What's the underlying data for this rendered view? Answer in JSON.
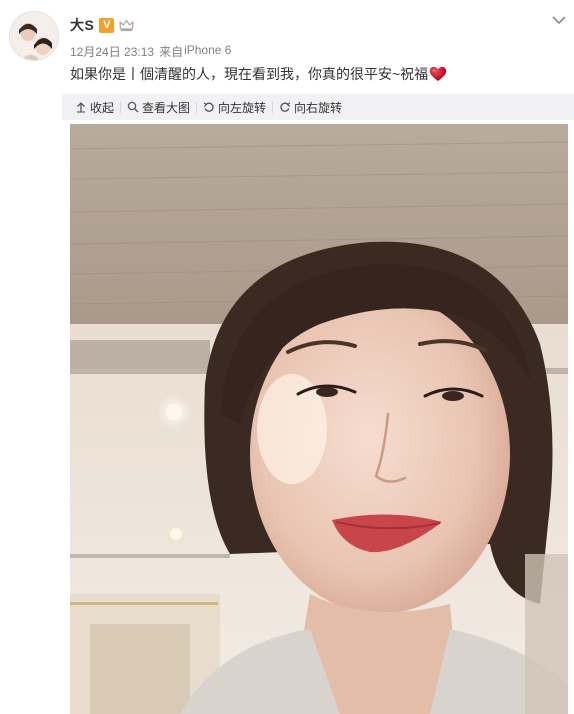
{
  "post": {
    "author": "大S",
    "verified_badge": "V",
    "time": "12月24日 23:13",
    "source_prefix": "来自",
    "source": "iPhone 6",
    "text": "如果你是丨個清醒的人，現在看到我，你真的很平安~祝福"
  },
  "toolbar": {
    "collapse_label": "收起",
    "view_large_label": "查看大图",
    "rotate_left_label": "向左旋转",
    "rotate_right_label": "向右旋转"
  },
  "icons": {
    "verified": "verified-badge",
    "member": "crown-icon",
    "heart": "heart-icon",
    "expand": "chevron-down-icon",
    "collapse": "collapse-icon",
    "zoom": "search-icon",
    "rotate_left": "rotate-left-icon",
    "rotate_right": "rotate-right-icon"
  },
  "colors": {
    "verified_badge": "#f0a02c",
    "heart": "#d0021b",
    "toolbar_bg": "#f2f2f5",
    "meta_text": "#808080"
  }
}
